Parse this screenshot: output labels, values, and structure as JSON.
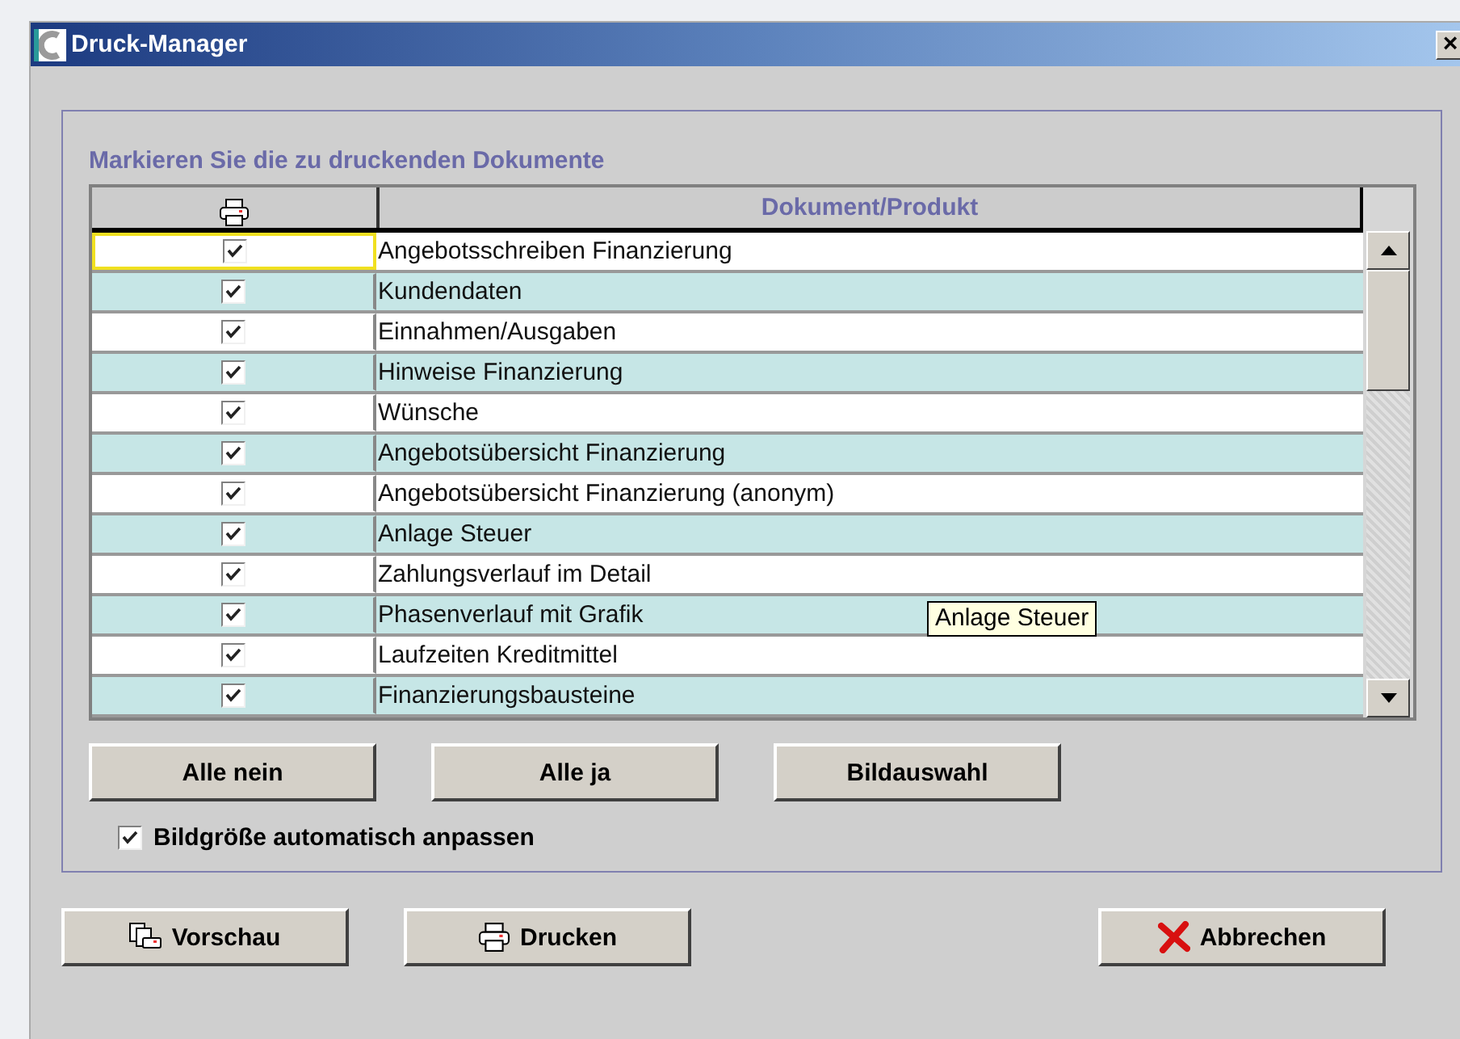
{
  "window": {
    "title": "Druck-Manager",
    "close": "×"
  },
  "group": {
    "title": "Markieren Sie die zu druckenden Dokumente"
  },
  "table": {
    "columns": [
      "Dokument/Produkt"
    ],
    "rows": [
      {
        "name": "Angebotsschreiben Finanzierung",
        "checked": true,
        "focused": true
      },
      {
        "name": "Kundendaten",
        "checked": true,
        "focused": false
      },
      {
        "name": "Einnahmen/Ausgaben",
        "checked": true,
        "focused": false
      },
      {
        "name": "Hinweise Finanzierung",
        "checked": true,
        "focused": false
      },
      {
        "name": "Wünsche",
        "checked": true,
        "focused": false
      },
      {
        "name": "Angebotsübersicht Finanzierung",
        "checked": true,
        "focused": false
      },
      {
        "name": "Angebotsübersicht Finanzierung (anonym)",
        "checked": true,
        "focused": false
      },
      {
        "name": "Anlage Steuer",
        "checked": true,
        "focused": false
      },
      {
        "name": "Zahlungsverlauf im Detail",
        "checked": true,
        "focused": false
      },
      {
        "name": "Phasenverlauf mit Grafik",
        "checked": true,
        "focused": false
      },
      {
        "name": "Laufzeiten Kreditmittel",
        "checked": true,
        "focused": false
      },
      {
        "name": "Finanzierungsbausteine",
        "checked": true,
        "focused": false
      }
    ]
  },
  "tooltip": "Anlage Steuer",
  "group_buttons": [
    "Alle nein",
    "Alle ja",
    "Bildauswahl"
  ],
  "auto_size": {
    "label": "Bildgröße automatisch anpassen",
    "checked": true
  },
  "buttons": [
    {
      "kind": "preview",
      "label": "Vorschau"
    },
    {
      "kind": "print",
      "label": "Drucken"
    },
    {
      "kind": "cancel",
      "label": "Abbrechen"
    }
  ]
}
